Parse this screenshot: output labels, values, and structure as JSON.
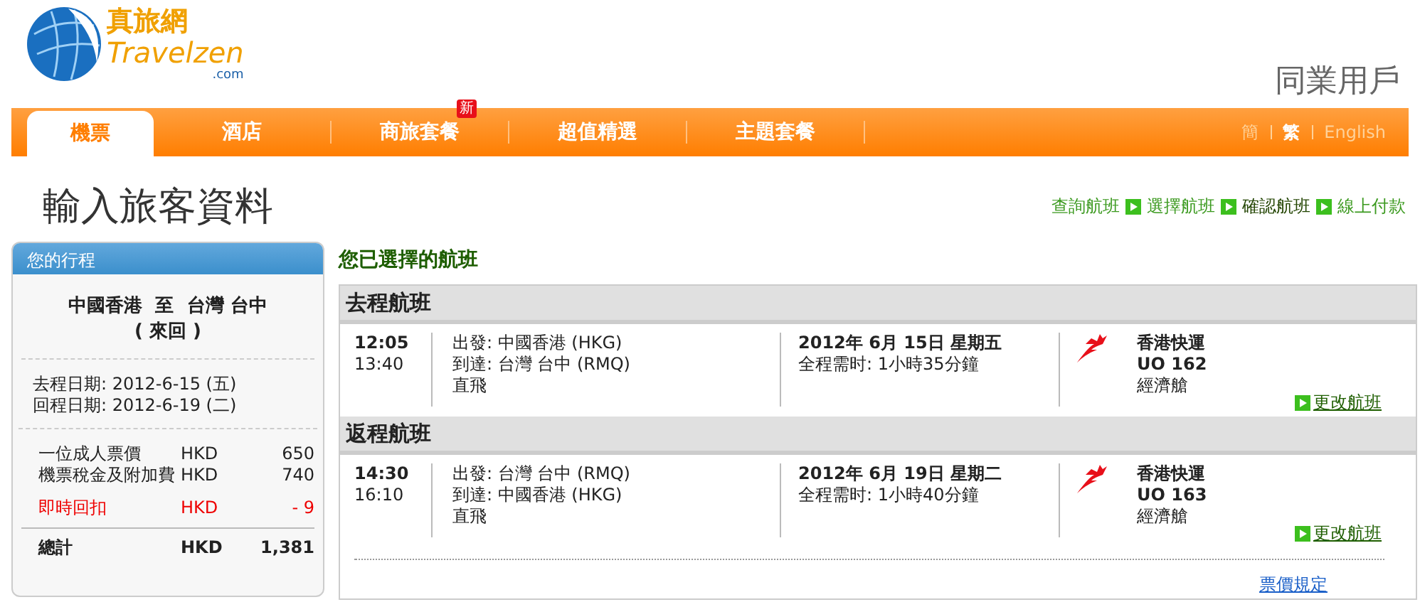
{
  "logo": {
    "chinese": "真旅網",
    "latin": "Travelzen",
    "domain": ".com"
  },
  "user_label": "同業用戶",
  "nav": {
    "tabs": [
      {
        "label": "機票",
        "selected": true
      },
      {
        "label": "酒店",
        "selected": false
      },
      {
        "label": "商旅套餐",
        "selected": false,
        "badge": "新"
      },
      {
        "label": "超值精選",
        "selected": false
      },
      {
        "label": "主題套餐",
        "selected": false
      }
    ],
    "languages": [
      {
        "label": "簡",
        "selected": false
      },
      {
        "label": "繁",
        "selected": true
      },
      {
        "label": "English",
        "selected": false
      }
    ]
  },
  "page_title": "輸入旅客資料",
  "steps": [
    {
      "label": "查詢航班",
      "selected": false
    },
    {
      "label": "選擇航班",
      "selected": false
    },
    {
      "label": "確認航班",
      "selected": true
    },
    {
      "label": "線上付款",
      "selected": false
    }
  ],
  "itinerary": {
    "title": "您的行程",
    "route": "中國香港  至  台灣 台中",
    "trip_type": "( 來回 )",
    "dates": [
      {
        "label": "去程日期:",
        "value": "2012-6-15 (五)"
      },
      {
        "label": "回程日期:",
        "value": "2012-6-19 (二)"
      }
    ],
    "fees": [
      {
        "label": "一位成人票價",
        "currency": "HKD",
        "amount": "650",
        "kind": "normal"
      },
      {
        "label": "機票稅金及附加費",
        "currency": "HKD",
        "amount": "740",
        "kind": "normal"
      },
      {
        "label": "即時回扣",
        "currency": "HKD",
        "amount": "- 9",
        "kind": "discount"
      }
    ],
    "total": {
      "label": "總計",
      "currency": "HKD",
      "amount": "1,381"
    }
  },
  "selected_flights": {
    "title": "您已選擇的航班",
    "flights": [
      {
        "heading": "去程航班",
        "depart_time": "12:05",
        "arrive_time": "13:40",
        "from": "出發: 中國香港 (HKG)",
        "to": "到達: 台灣 台中 (RMQ)",
        "stops": "直飛",
        "date": "2012年 6月 15日 星期五",
        "duration": "全程需时: 1小時35分鐘",
        "airline": "香港快運",
        "flight_no": "UO 162",
        "cabin": "經濟艙",
        "change": "更改航班"
      },
      {
        "heading": "返程航班",
        "depart_time": "14:30",
        "arrive_time": "16:10",
        "from": "出發: 台灣 台中 (RMQ)",
        "to": "到達: 中國香港 (HKG)",
        "stops": "直飛",
        "date": "2012年 6月 19日 星期二",
        "duration": "全程需时: 1小時40分鐘",
        "airline": "香港快運",
        "flight_no": "UO 163",
        "cabin": "經濟艙",
        "change": "更改航班"
      }
    ],
    "fare_rules": "票價規定"
  }
}
